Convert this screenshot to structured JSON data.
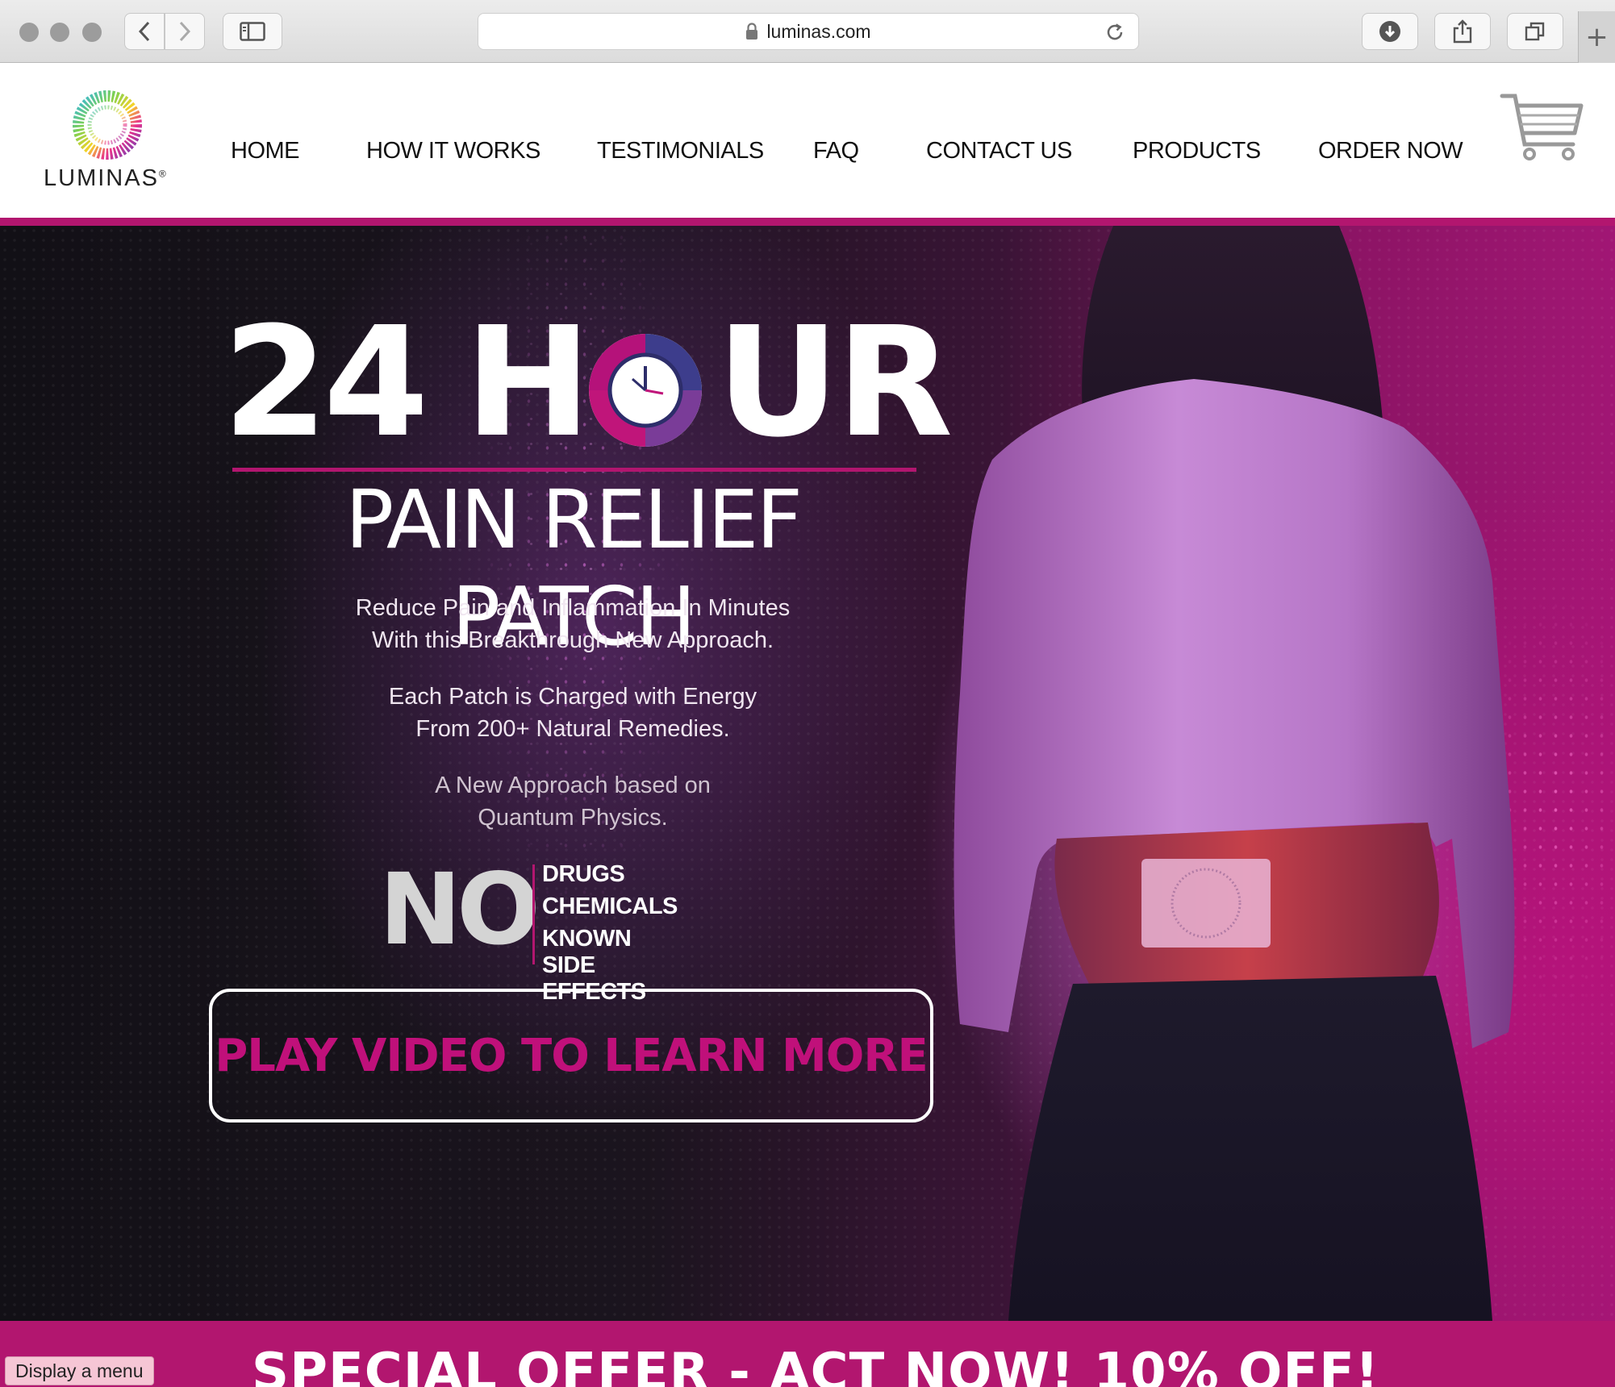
{
  "browser": {
    "url": "luminas.com",
    "new_tab_glyph": "+"
  },
  "site": {
    "logo_text": "LUMINAS",
    "logo_mark": "®",
    "nav": [
      "HOME",
      "HOW IT WORKS",
      "TESTIMONIALS",
      "FAQ",
      "CONTACT US",
      "PRODUCTS",
      "ORDER NOW"
    ],
    "accent": "#b2166f"
  },
  "hero": {
    "headline_24": "24",
    "headline_h": "H",
    "headline_ur": "UR",
    "subheadline": "PAIN RELIEF PATCH",
    "para1_line1": "Reduce Pain and Inflammation In Minutes",
    "para1_line2": "With this Breakthrough New Approach.",
    "para2_line1": "Each Patch is Charged with Energy",
    "para2_line2": "From 200+ Natural Remedies.",
    "para3_line1": "A New Approach based on",
    "para3_line2": "Quantum Physics.",
    "no_word": "NO",
    "no_items": [
      "DRUGS",
      "CHEMICALS",
      "KNOWN SIDE EFFECTS"
    ],
    "cta": "PLAY VIDEO TO LEARN MORE"
  },
  "offer": {
    "text": "SPECIAL OFFER - ACT NOW! 10% OFF!"
  },
  "tooltip": {
    "text": "Display a menu"
  }
}
